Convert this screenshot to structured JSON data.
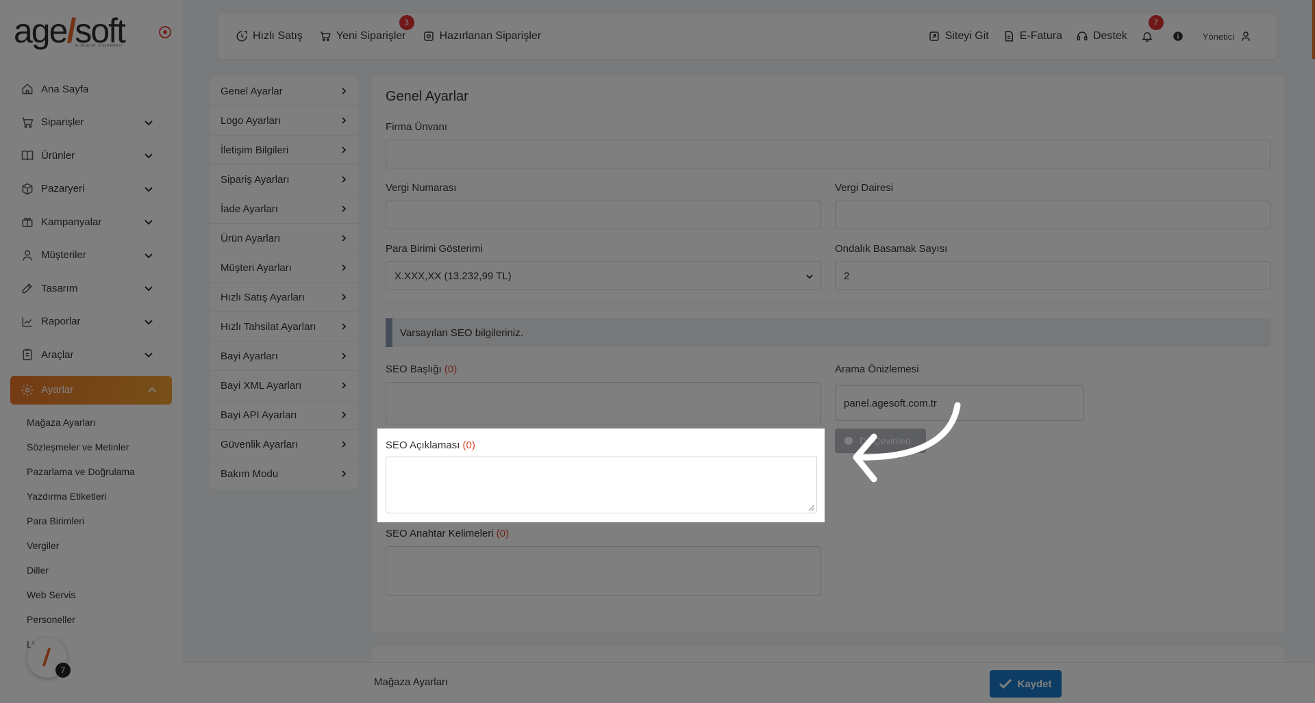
{
  "brand": {
    "logo_left": "age",
    "logo_slash": "/",
    "logo_right": "soft",
    "logo_sub": "e-ticaret sistemleri"
  },
  "sidebar": {
    "items": [
      {
        "label": "Ana Sayfa",
        "icon": "home-icon"
      },
      {
        "label": "Siparişler",
        "icon": "cart-icon"
      },
      {
        "label": "Ürünler",
        "icon": "book-icon"
      },
      {
        "label": "Pazaryeri",
        "icon": "box-icon"
      },
      {
        "label": "Kampanyalar",
        "icon": "gift-icon"
      },
      {
        "label": "Müşteriler",
        "icon": "user-icon"
      },
      {
        "label": "Tasarım",
        "icon": "edit-icon"
      },
      {
        "label": "Raporlar",
        "icon": "chart-icon"
      },
      {
        "label": "Araçlar",
        "icon": "clipboard-icon"
      }
    ],
    "active": {
      "label": "Ayarlar",
      "icon": "gear-icon"
    },
    "submenu": [
      "Mağaza Ayarları",
      "Sözleşmeler ve Metinler",
      "Pazarlama ve Doğrulama",
      "Yazdırma Etiketleri",
      "Para Birimleri",
      "Vergiler",
      "Diller",
      "Web Servis",
      "Personeller",
      "Lis"
    ],
    "help_badge": "7"
  },
  "topbar": {
    "quick_sale": "Hızlı Satış",
    "new_orders": "Yeni Siparişler",
    "new_orders_badge": "3",
    "preparing_orders": "Hazırlanan Siparişler",
    "go_site": "Siteyi Git",
    "e_invoice": "E-Fatura",
    "support": "Destek",
    "notifications_badge": "7",
    "user": "Yönetici"
  },
  "settings_menu": [
    "Genel Ayarlar",
    "Logo Ayarları",
    "İletişim Bilgileri",
    "Sipariş Ayarları",
    "İade Ayarları",
    "Ürün Ayarları",
    "Müşteri Ayarları",
    "Hızlı Satış Ayarları",
    "Hızlı Tahsilat Ayarları",
    "Bayi Ayarları",
    "Bayi XML Ayarları",
    "Bayi API Ayarları",
    "Güvenlik Ayarları",
    "Bakım Modu"
  ],
  "form": {
    "title": "Genel Ayarlar",
    "company_label": "Firma Ünvanı",
    "company_value": "",
    "tax_no_label": "Vergi Numarası",
    "tax_no_value": "",
    "tax_office_label": "Vergi Dairesi",
    "tax_office_value": "",
    "currency_label": "Para Birimi Gösterimi",
    "currency_value": "X.XXX,XX (13.232,99 TL)",
    "decimal_label": "Ondalık Basamak Sayısı",
    "decimal_value": "2",
    "seo_info": "Varsayılan SEO bilgileriniz.",
    "seo_title_label": "SEO Başlığı",
    "seo_title_count": "(0)",
    "search_preview_label": "Arama Önizlemesi",
    "search_preview_value": "panel.agesoft.com.tr",
    "translate_button": "Dil Çevirileri",
    "seo_desc_label": "SEO Açıklaması",
    "seo_desc_count": "(0)",
    "seo_keywords_label": "SEO Anahtar Kelimeleri",
    "seo_keywords_count": "(0)"
  },
  "bottombar": {
    "page_label": "Mağaza Ayarları",
    "save_button": "Kaydet"
  }
}
